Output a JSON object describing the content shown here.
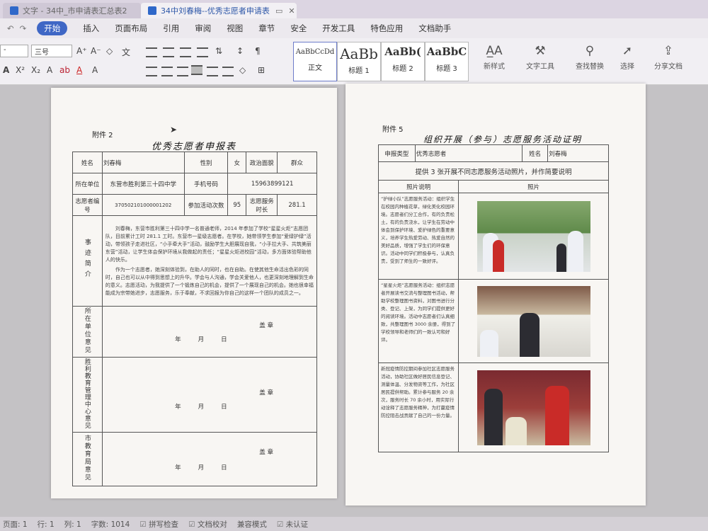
{
  "window": {
    "tabs": [
      {
        "label": "文字 - 34中_市申请表汇总表2"
      },
      {
        "label": "34中刘春梅--优秀志愿者申请表"
      }
    ]
  },
  "menu": {
    "items": [
      "开始",
      "插入",
      "页面布局",
      "引用",
      "审阅",
      "视图",
      "章节",
      "安全",
      "开发工具",
      "特色应用",
      "文档助手"
    ]
  },
  "ribbon": {
    "font_size": "三号",
    "styles": [
      {
        "sample": "AaBbCcDd",
        "label": "正文"
      },
      {
        "sample": "AaBb",
        "label": "标题 1"
      },
      {
        "sample": "AaBb(",
        "label": "标题 2"
      },
      {
        "sample": "AaBbC",
        "label": "标题 3"
      }
    ],
    "new_style": "新样式",
    "tools": [
      {
        "label": "文字工具",
        "icon": "wrench-icon"
      },
      {
        "label": "查找替换",
        "icon": "search-icon"
      },
      {
        "label": "选择",
        "icon": "cursor-icon"
      },
      {
        "label": "分享文档",
        "icon": "share-icon"
      }
    ]
  },
  "page_left": {
    "attachment": "附件 2",
    "title": "优秀志愿者申报表",
    "row1": {
      "name_label": "姓名",
      "name": "刘春梅",
      "gender_label": "性别",
      "gender": "女",
      "politics_label": "政治面貌",
      "politics": "群众"
    },
    "row2": {
      "unit_label": "所在单位",
      "unit": "东营市胜利第三十四中学",
      "phone_label": "手机号码",
      "phone": "15963899121"
    },
    "row3": {
      "id_label": "志愿者编号",
      "id": "370502101000001202",
      "count_label": "参加活动次数",
      "count": "95",
      "hours_label": "志愿服务时长",
      "hours": "281.1"
    },
    "bio_label": "事迹简介",
    "bio_p1": "刘春梅，东营市胜利第三十四中学一名普通老师，2014 年参加了学校“星星火炬”志愿团队，目前累计工时 281.1 工时。东营市一星级志愿者。在学校，她带领学生参加“爱绿护绿”活动，带领孩子走进社区，“小手牵大手”活动，鼓励学生大胆展现自我，“小手拉大手、共筑美丽东营”活动，让学生体会保护环境从我做起的责任；“星星火炬进校园”活动，多方面体验帮助他人的快乐。",
    "bio_p2": "作为一个志愿者，她深刻体验到，在助人的同时，也在自助。在使其他生命活出色彩的同时，自己也可以从中得到思想上的升华。学会与人沟通，学会关爱他人，也更深刻地理解到生命的意义。志愿活动，为我提供了一个锻炼自己的机会，提供了一个展现自己的机会。她也很幸福能成为宗带她进步，志愿服务，乐于奉献，不求回报为你自己的这样一个团队的成员之一。",
    "unit_opinion_label": "所在单位意见",
    "edu_opinion_label": "胜利教育管理中心意见",
    "city_opinion_label": "市教育局意见",
    "seal": "盖 章",
    "date": "年月日"
  },
  "page_right": {
    "attachment": "附件 5",
    "title": "组织开展（参与）志愿服务活动证明",
    "type_label": "申报类型",
    "type_value": "优秀志愿者",
    "name_label": "姓名",
    "name_value": "刘春梅",
    "instruction": "提供 3 张开展不同志愿服务活动照片，并作简要说明",
    "col_desc": "照片说明",
    "col_photo": "照片",
    "photos": [
      {
        "desc": "“护绿小队”志愿服务活动：组织学生在校园内种植花草，绿化美化校园环境。志愿者们分工合作，有的负责松土，有的负责浇水，让学生在劳动中体会到保护环境、爱护绿色的重要意义，培养学生热爱劳动、热爱自然的美好品质，增强了学生们的环保意识。活动中同学们积极参与，认真负责，受到了师生的一致好评。"
      },
      {
        "desc": "“星星火炬”志愿服务活动：组织志愿者开展读书交流与整理图书活动，帮助学校整理图书资料，对图书进行分类、登记、上架，为同学们提供更好的阅读环境。活动中志愿者们认真细致，共整理图书 3000 余册，得到了学校领导和老师们的一致认可和好评。"
      },
      {
        "desc": "新冠疫情防控期间参加社区志愿服务活动，协助社区做好居民信息登记、测量体温、分发物资等工作，为社区居民提供帮助。累计参与服务 20 余次，服务时长 70 余小时，用实际行动诠释了志愿服务精神，为打赢疫情防控阻击战贡献了自己的一份力量。"
      }
    ]
  },
  "status": {
    "page": "页面: 1",
    "row": "行: 1",
    "col": "列: 1",
    "words": "字数: 1014",
    "spell": "拼写检查",
    "proof": "文档校对",
    "compat": "兼容模式",
    "cert": "未认证"
  }
}
